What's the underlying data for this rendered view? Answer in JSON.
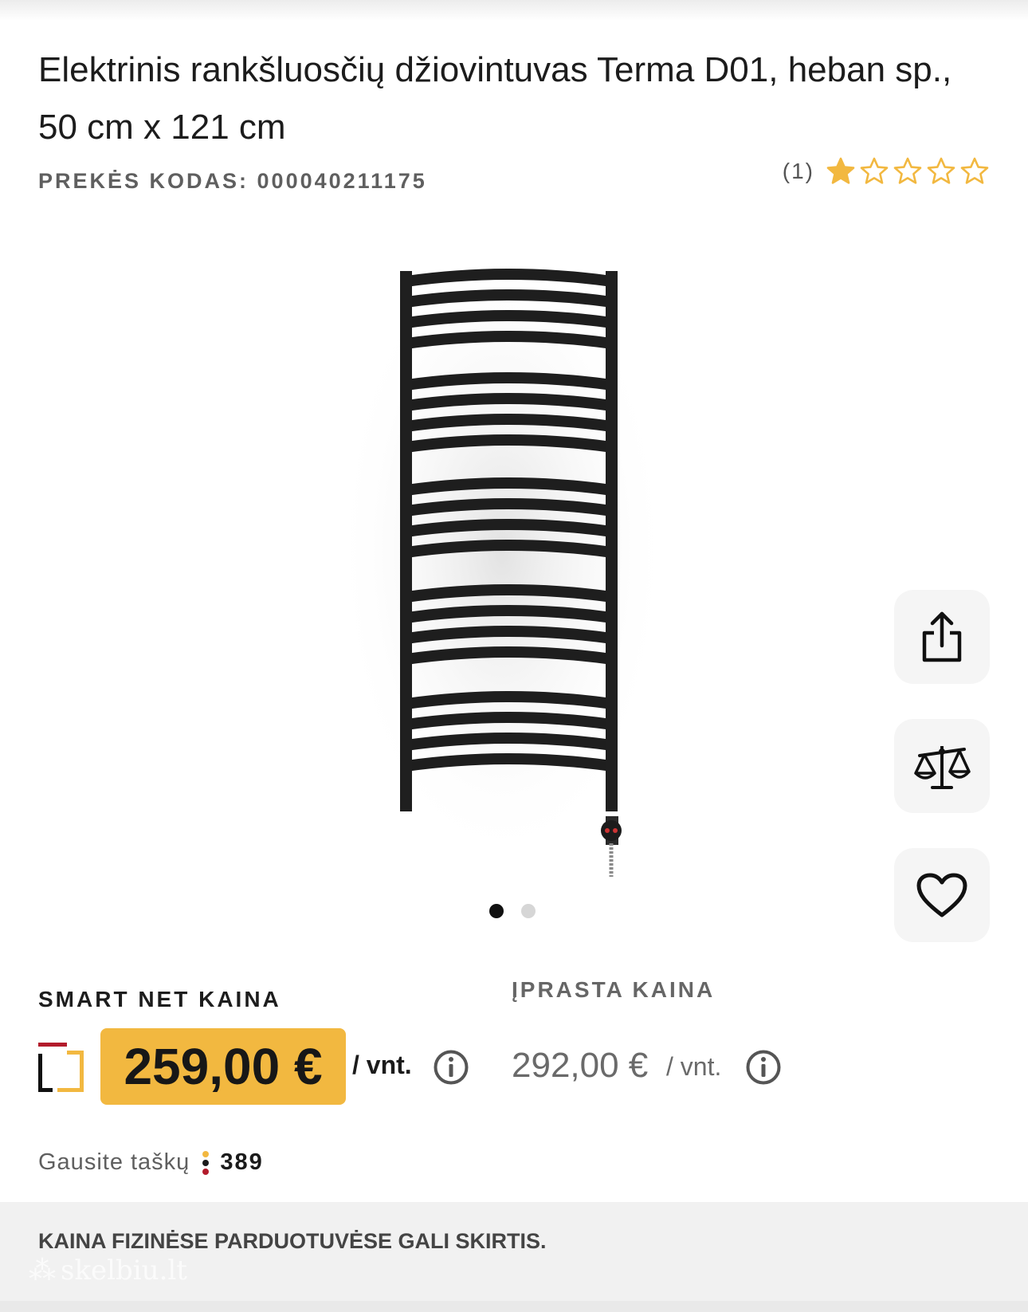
{
  "product": {
    "title": "Elektrinis rankšluosčių džiovintuvas Terma D01, heban sp., 50 cm x 121 cm",
    "sku": "PREKĖS KODAS: 000040211175"
  },
  "rating": {
    "count": "(1)",
    "value": 1,
    "max": 5,
    "star_color": "#F2B840"
  },
  "gallery": {
    "total_images": 2,
    "active_index": 0
  },
  "actions": {
    "share_icon": "share-icon",
    "compare_icon": "scales-icon",
    "wishlist_icon": "heart-icon"
  },
  "pricing": {
    "smart_label": "SMART NET KAINA",
    "smart_price": "259,00 €",
    "smart_unit": "/ vnt.",
    "smart_badge_color": "#F2B840",
    "regular_label": "ĮPRASTA KAINA",
    "regular_price": "292,00 €",
    "regular_unit": "/ vnt."
  },
  "points": {
    "label": "Gausite taškų",
    "value": "389"
  },
  "notice": {
    "text": "KAINA FIZINĖSE PARDUOTUVĖSE GALI SKIRTIS."
  },
  "watermark": {
    "text": "skelbiu.lt"
  }
}
